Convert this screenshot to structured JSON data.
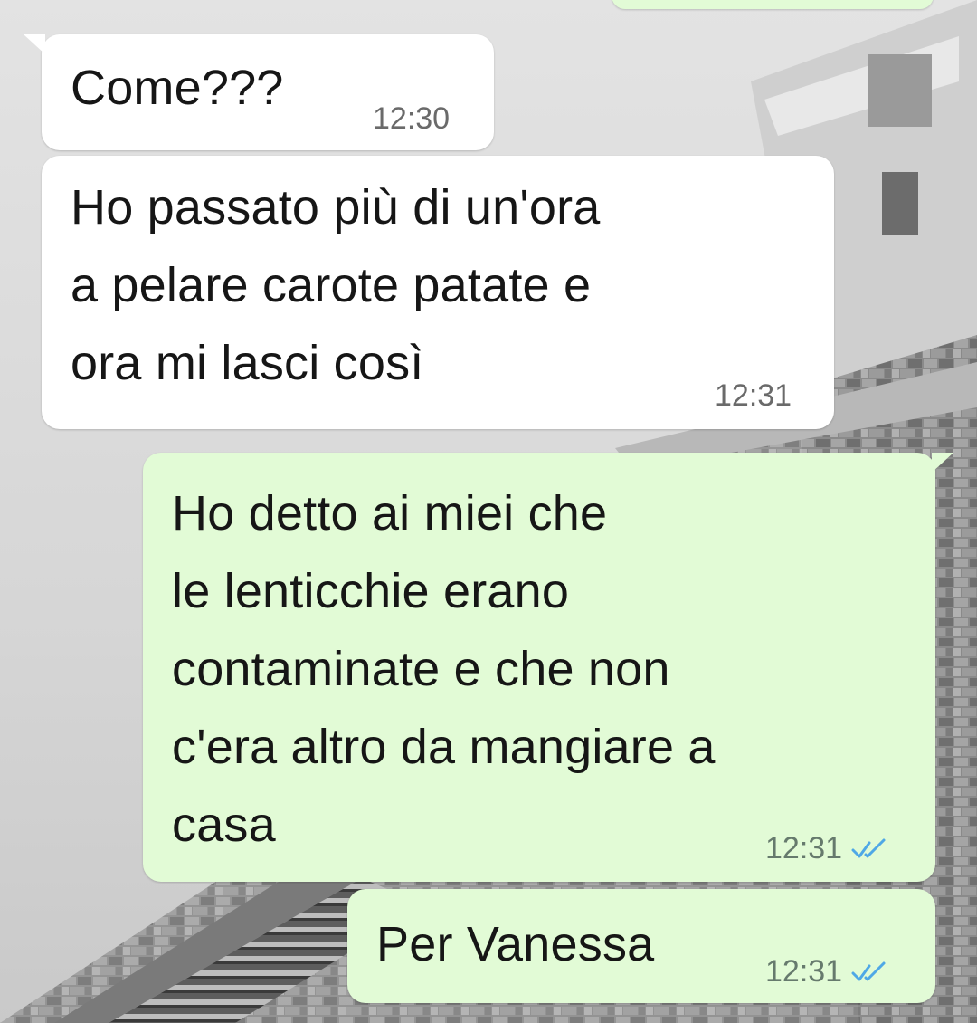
{
  "chat": {
    "messages": [
      {
        "direction": "incoming",
        "text": "Come???",
        "time": "12:30"
      },
      {
        "direction": "incoming",
        "text": "Ho passato più di un'ora\na pelare carote patate e\nora mi lasci così",
        "time": "12:31"
      },
      {
        "direction": "outgoing",
        "text": "Ho detto ai miei che\nle lenticchie erano\ncontaminate e che non\nc'era altro da mangiare a\ncasa",
        "time": "12:31",
        "status_icon": "double-check-icon",
        "status_color": "#4fa8e6"
      },
      {
        "direction": "outgoing",
        "text": "Per Vanessa",
        "time": "12:31",
        "status_icon": "double-check-icon",
        "status_color": "#4fa8e6"
      }
    ]
  },
  "colors": {
    "incoming_bubble": "#ffffff",
    "outgoing_bubble": "#e2fbd6",
    "text": "#161616",
    "read_tick": "#4fa8e6"
  },
  "background": {
    "wallpaper": "grayscale photo of a stepped stone pyramid"
  }
}
